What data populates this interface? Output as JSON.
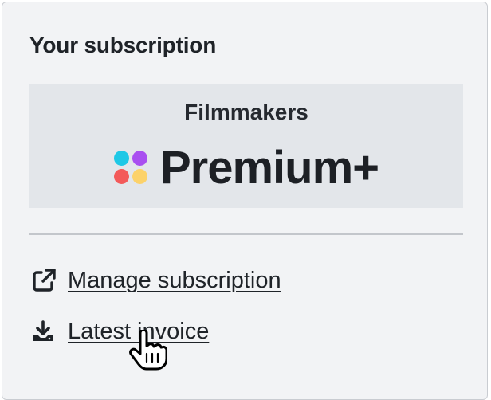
{
  "subscription": {
    "title": "Your subscription",
    "plan_group": "Filmmakers",
    "plan_tier": "Premium+",
    "logo_colors": [
      "#1ec8e6",
      "#a94ff0",
      "#f35a5a",
      "#fcd26a"
    ]
  },
  "links": {
    "manage_label": "Manage subscription",
    "manage_icon": "external-link-icon",
    "invoice_label": "Latest invoice",
    "invoice_icon": "download-icon"
  },
  "cursor": {
    "type": "hand-pointer-icon"
  }
}
